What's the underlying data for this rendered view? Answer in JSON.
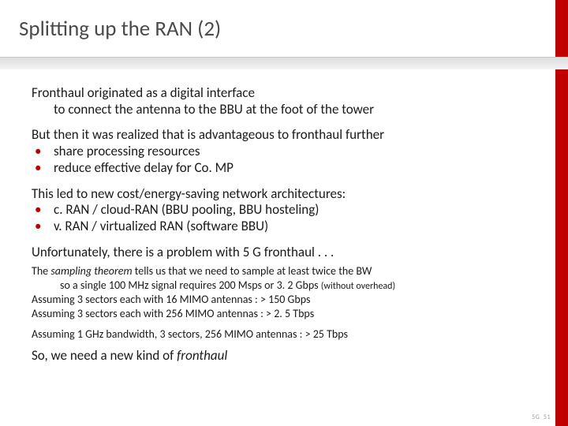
{
  "slide": {
    "title": "Splitting up the RAN (2)",
    "p1_line1": "Fronthaul originated as a digital interface",
    "p1_line2": "to connect the antenna to the BBU at the foot of the tower",
    "p2_lead": "But then it was realized that is advantageous to fronthaul further",
    "p2_b1": "share processing resources",
    "p2_b2": "reduce effective delay for Co. MP",
    "p3_lead": "This led to new cost/energy-saving network architectures:",
    "p3_b1": "c. RAN / cloud-RAN (BBU pooling, BBU hosteling)",
    "p3_b2": "v. RAN / virtualized RAN (software BBU)",
    "p4": "Unfortunately, there is a problem with 5 G fronthaul . . .",
    "sm1a": "The ",
    "sm1b_italic": "sampling theorem",
    "sm1c": " tells us that we need to sample at least twice the BW",
    "sm2a": "so a single 100 MHz signal requires 200 Msps or 3. 2 Gbps ",
    "sm2b_small": "(without overhead)",
    "sm3": "Assuming 3 sectors each with 16 MIMO antennas : > 150 Gbps",
    "sm4": "Assuming 3 sectors each with 256 MIMO antennas : > 2. 5 Tbps",
    "sm5": "Assuming 1 GHz bandwidth, 3 sectors, 256 MIMO antennas : > 25 Tbps",
    "p5a": "So, we need a new kind of ",
    "p5b_italic": "fronthaul",
    "footer_left": "5G",
    "footer_right": "51"
  }
}
